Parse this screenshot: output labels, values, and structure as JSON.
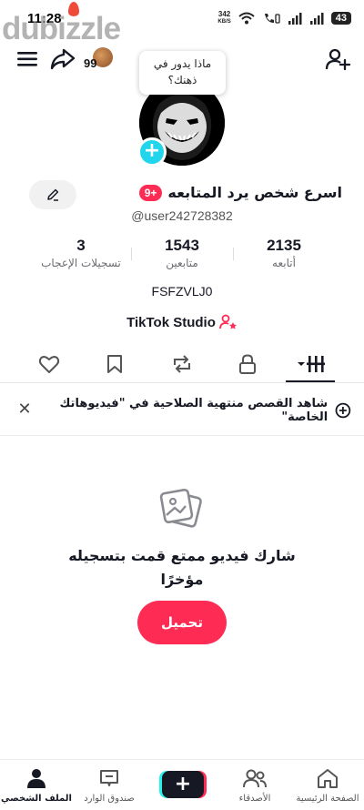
{
  "status_bar": {
    "time": "11:28",
    "speed_value": "342",
    "speed_unit": "KB/S",
    "battery": "43"
  },
  "watermark": "dubizzle",
  "header": {
    "friends_count": "99"
  },
  "thought_bubble": {
    "text": "ماذا يدور في ذهنك؟"
  },
  "profile": {
    "nickname": "اسرع شخص يرد المتابعه",
    "followers_badge": "+9",
    "username": "@user242728382",
    "bio": "FSFZVLJ0",
    "studio_label": "TikTok Studio"
  },
  "stats": [
    {
      "value": "2135",
      "label": "أتابعه"
    },
    {
      "value": "1543",
      "label": "متابعين"
    },
    {
      "value": "3",
      "label": "تسجيلات الإعجاب"
    }
  ],
  "tabs": [
    "videos-tab",
    "private-tab",
    "reposts-tab",
    "favorites-tab",
    "liked-tab"
  ],
  "banner": {
    "text": "شاهد القصص منتهية الصلاحية في \"فيديوهاتك الخاصة\""
  },
  "empty_state": {
    "text": "شارك فيديو ممتع قمت بتسجيله مؤخرًا",
    "button": "تحميل"
  },
  "bottom_nav": {
    "home": "الصفحة الرئيسية",
    "friends": "الأصدقاء",
    "create": "+",
    "inbox": "صندوق الوارد",
    "profile": "الملف الشخصي"
  },
  "colors": {
    "accent": "#fe2c55",
    "avatar_badge": "#20d5ec",
    "studio_icon": "#fe2c55"
  }
}
